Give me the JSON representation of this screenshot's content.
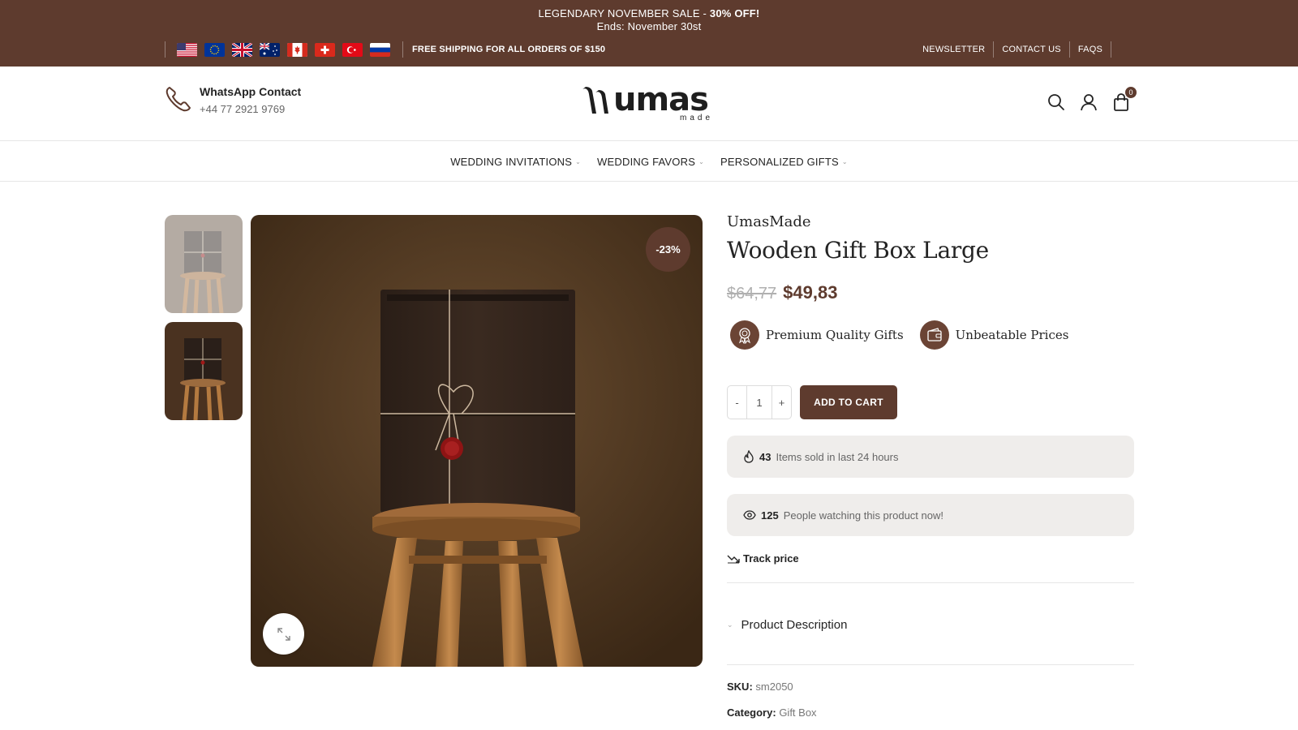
{
  "topbar": {
    "promo_line1_normal": "LEGENDARY NOVEMBER SALE - ",
    "promo_line1_bold": "30% OFF!",
    "promo_line2": "Ends: November 30st",
    "shipping": "FREE SHIPPING FOR ALL ORDERS OF $150",
    "flags": [
      "us-flag",
      "eu-flag",
      "uk-flag",
      "australia-flag",
      "canada-flag",
      "switzerland-flag",
      "turkey-flag",
      "russia-flag"
    ],
    "links": [
      "NEWSLETTER",
      "CONTACT US",
      "FAQS"
    ]
  },
  "header": {
    "contact_title": "WhatsApp Contact",
    "contact_number": "+44 77 2921 9769",
    "logo_text": "umas",
    "logo_sub": "made",
    "cart_count": "0"
  },
  "nav": {
    "items": [
      {
        "label": "WEDDING INVITATIONS"
      },
      {
        "label": "WEDDING FAVORS"
      },
      {
        "label": "PERSONALIZED GIFTS"
      }
    ]
  },
  "product": {
    "discount": "-23%",
    "brand": "UmasMade",
    "title": "Wooden Gift Box Large",
    "old_price": "$64,77",
    "new_price": "$49,83",
    "badges": [
      {
        "label": "Premium Quality Gifts",
        "icon": "award-icon"
      },
      {
        "label": "Unbeatable Prices",
        "icon": "wallet-icon"
      }
    ],
    "qty_minus": "-",
    "qty_value": "1",
    "qty_plus": "+",
    "add_to_cart": "ADD TO CART",
    "sold_count": "43",
    "sold_text": "Items sold in last 24 hours",
    "watching_count": "125",
    "watching_text": "People watching this product now!",
    "track_price": "Track price",
    "accordion": "Product Description",
    "sku_label": "SKU:",
    "sku_value": "sm2050",
    "category_label": "Category:",
    "category_value": "Gift Box"
  },
  "colors": {
    "brand_brown": "#5e3b2e",
    "info_bg": "#efedeb"
  }
}
